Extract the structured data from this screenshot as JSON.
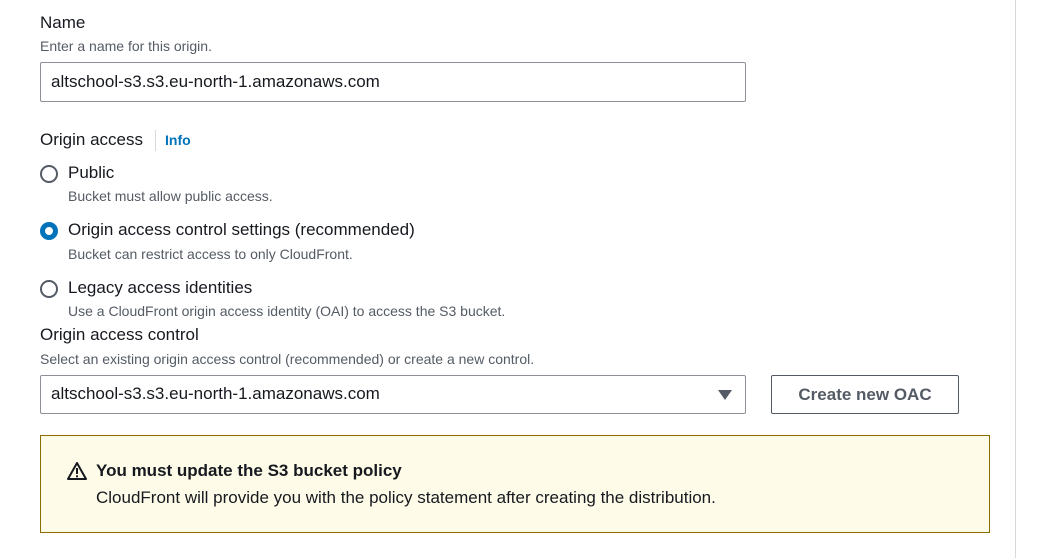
{
  "name_field": {
    "label": "Name",
    "description": "Enter a name for this origin.",
    "value": "altschool-s3.s3.eu-north-1.amazonaws.com"
  },
  "origin_access": {
    "label": "Origin access",
    "info_link": "Info",
    "options": [
      {
        "label": "Public",
        "description": "Bucket must allow public access.",
        "selected": false
      },
      {
        "label": "Origin access control settings (recommended)",
        "description": "Bucket can restrict access to only CloudFront.",
        "selected": true
      },
      {
        "label": "Legacy access identities",
        "description": "Use a CloudFront origin access identity (OAI) to access the S3 bucket.",
        "selected": false
      }
    ]
  },
  "oac": {
    "label": "Origin access control",
    "description": "Select an existing origin access control (recommended) or create a new control.",
    "selected_value": "altschool-s3.s3.eu-north-1.amazonaws.com",
    "create_button": "Create new OAC"
  },
  "alert": {
    "icon": "warning-icon",
    "title": "You must update the S3 bucket policy",
    "body": "CloudFront will provide you with the policy statement after creating the distribution."
  },
  "colors": {
    "link": "#0073bb",
    "radio_selected": "#0073bb",
    "warning_bg": "#fefbe8",
    "warning_border": "#8c6d00"
  }
}
